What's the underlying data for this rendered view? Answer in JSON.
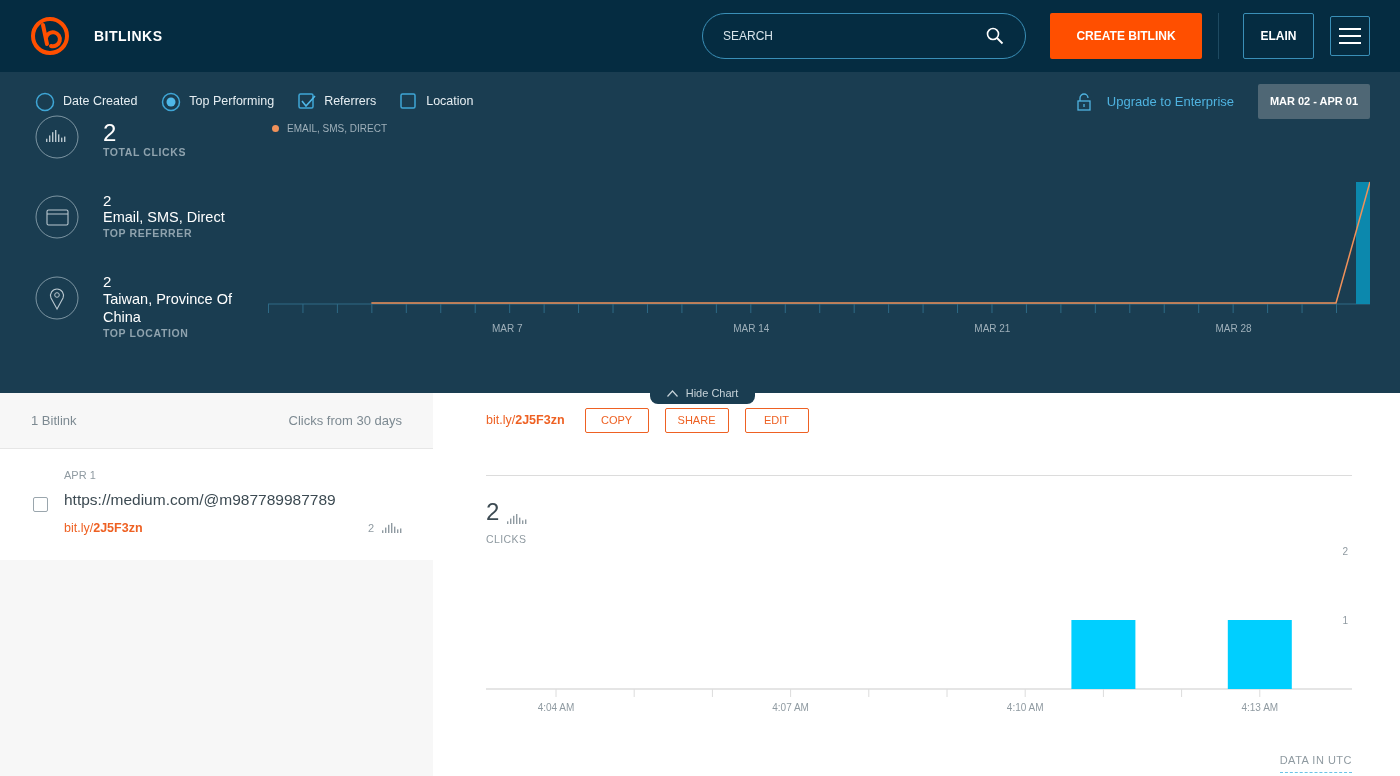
{
  "top_bar": {
    "logo_text": "BITLINKS",
    "search": {
      "placeholder": "SEARCH"
    },
    "create_button": "CREATE BITLINK",
    "user_button": "ELAIN"
  },
  "filters": [
    {
      "kind": "radio",
      "label": "Date Created",
      "selected": false
    },
    {
      "kind": "radio",
      "label": "Top Performing",
      "selected": true
    },
    {
      "kind": "checkbox",
      "label": "Referrers",
      "checked": true
    },
    {
      "kind": "checkbox",
      "label": "Location",
      "checked": false
    }
  ],
  "upgrade_link": "Upgrade to Enterprise",
  "date_range": "MAR 02 - APR 01",
  "stats": [
    {
      "kind": "clicks",
      "value": "2",
      "label": "TOTAL CLICKS"
    },
    {
      "kind": "referrer",
      "value": "2",
      "name": "Email, SMS, Direct",
      "label": "TOP REFERRER"
    },
    {
      "kind": "location",
      "value": "2",
      "name": "Taiwan, Province Of China",
      "label": "TOP LOCATION"
    }
  ],
  "trend_chart": {
    "legend": "EMAIL, SMS, DIRECT",
    "axis_labels": [
      "MAR 7",
      "MAR 14",
      "MAR 21",
      "MAR 28"
    ]
  },
  "hide_chart": "Hide Chart",
  "bitlink_list": {
    "count": "1 Bitlink",
    "period": "Clicks from 30 days",
    "items": [
      {
        "date": "APR 1",
        "url": "https://medium.com/@m987789987789",
        "short_link": "bit.ly/**2J5F3zn**",
        "clicks": "2",
        "checked": false
      }
    ]
  },
  "detail": {
    "short_link": "bit.ly/**2J5F3zn**",
    "actions": [
      "COPY",
      "SHARE",
      "EDIT"
    ],
    "clicks": "2",
    "clicks_label": "CLICKS",
    "chart_data": {
      "type": "bar",
      "categories": [
        "4:04 AM",
        null,
        null,
        "4:07 AM",
        null,
        null,
        "4:10 AM",
        null,
        null,
        "4:13 AM"
      ],
      "values": [
        0,
        0,
        0,
        0,
        0,
        0,
        0,
        1,
        0,
        1
      ],
      "ylim": [
        0,
        2
      ],
      "yticks": [
        1,
        2
      ]
    },
    "footnote": "DATA IN UTC"
  }
}
